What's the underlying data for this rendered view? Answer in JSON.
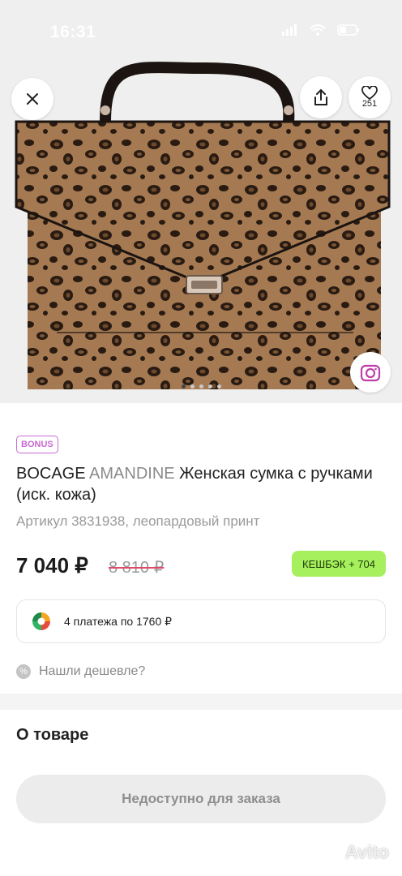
{
  "status_bar": {
    "time": "16:31"
  },
  "hero": {
    "favorites_count": "251",
    "photo_count": 5,
    "active_photo_index": 0
  },
  "product": {
    "bonus_badge": "BONUS",
    "title_brand": "BOCAGE",
    "title_model": "AMANDINE",
    "title_rest": "Женская сумка с ручками (иск. кожа)",
    "sku_line": "Артикул 3831938, леопардовый принт",
    "price": "7 040 ₽",
    "old_price": "8 810 ₽",
    "cashback": "КЕШБЭК + 704",
    "installments": "4 платежа по 1760 ₽",
    "found_cheaper": "Нашли дешевле?"
  },
  "about": {
    "title": "О товаре",
    "order_button": "Недоступно для заказа"
  },
  "watermark": "Avito",
  "colors": {
    "bonus": "#c86ad2",
    "cashback_bg": "#a6ef5d",
    "strike": "#e04b6a",
    "camera_accent": "#c13fa8"
  }
}
